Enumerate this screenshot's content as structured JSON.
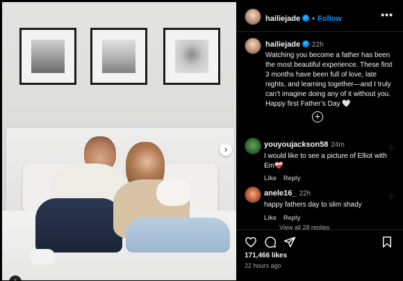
{
  "post": {
    "author": "hailiejade",
    "follow_label": "Follow",
    "dot": "•",
    "more": "•••"
  },
  "caption": {
    "author": "hailiejade",
    "time": "22h",
    "text": "Watching you become a father has been the most beautiful experience. These first 3 months have been full of love, late nights, and learning together—and I truly can’t imagine doing any of it without you. Happy first Father’s Day 🤍"
  },
  "add_icon": "+",
  "comments": [
    {
      "author": "youyoujackson58",
      "time": "24m",
      "text": "I would like to see a picture of Elliot with Em❤️‍🩹",
      "like_label": "Like",
      "reply_label": "Reply"
    },
    {
      "author": "anele16_",
      "time": "22h",
      "text": "happy fathers day to slim shady",
      "like_label": "Like",
      "reply_label": "Reply"
    }
  ],
  "view_all_text": "View all 28 replies",
  "footer": {
    "likes": "171,466 likes",
    "time_ago": "22 hours ago"
  },
  "icons": {
    "like": "heart-icon",
    "comment": "comment-icon",
    "share": "share-icon",
    "save": "bookmark-icon",
    "next": "chevron-right-icon"
  },
  "colors": {
    "accent": "#0095f6",
    "background": "#000000",
    "muted_text": "#a8a8a8"
  }
}
